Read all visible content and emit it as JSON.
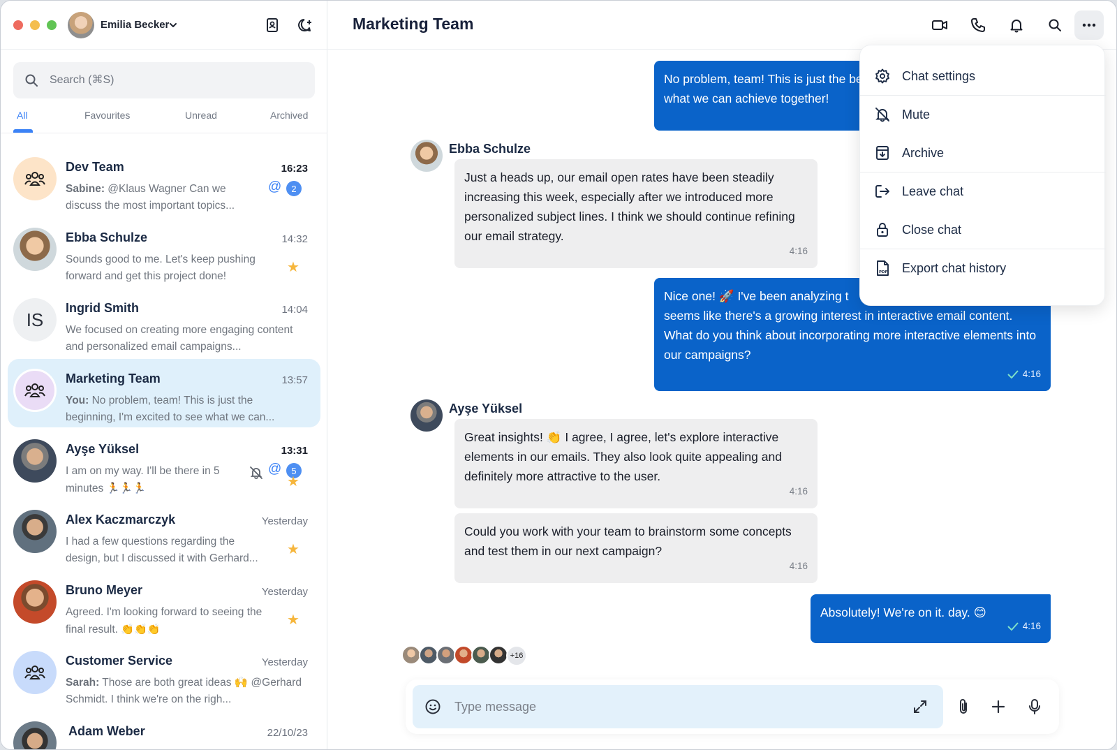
{
  "user": {
    "name": "Emilia Becker"
  },
  "search": {
    "placeholder": "Search (⌘S)"
  },
  "tabs": [
    {
      "label": "All"
    },
    {
      "label": "Favourites"
    },
    {
      "label": "Unread"
    },
    {
      "label": "Archived"
    }
  ],
  "chats": [
    {
      "name": "Dev Team",
      "time": "16:23",
      "sender": "Sabine:",
      "preview": "@Klaus Wagner Can we discuss the most important topics...",
      "badge": "2",
      "at": "@"
    },
    {
      "name": "Ebba Schulze",
      "time": "14:32",
      "preview": "Sounds good to me. Let's keep pushing forward and get this project done!"
    },
    {
      "name": "Ingrid Smith",
      "time": "14:04",
      "initials": "IS",
      "preview": "We focused on creating more engaging content and personalized email campaigns..."
    },
    {
      "name": "Marketing Team",
      "time": "13:57",
      "sender": "You:",
      "preview": "No problem, team! This is just the beginning, I'm excited to see what we can..."
    },
    {
      "name": "Ayşe Yüksel",
      "time": "13:31",
      "preview": "I am on my way. I'll be there in 5 minutes",
      "preview_emoji": "🏃🏃🏃",
      "badge": "5",
      "at": "@"
    },
    {
      "name": "Alex Kaczmarczyk",
      "time": "Yesterday",
      "preview": "I had a few questions regarding the design, but I discussed it with Gerhard..."
    },
    {
      "name": "Bruno Meyer",
      "time": "Yesterday",
      "preview": "Agreed. I'm looking forward to seeing the final result.",
      "preview_emoji": "👏👏👏"
    },
    {
      "name": "Customer Service",
      "time": "Yesterday",
      "sender": "Sarah:",
      "preview": "Those are both great ideas 🙌 @Gerhard Schmidt. I think we're on the righ..."
    },
    {
      "name": "Adam Weber",
      "time": "22/10/23"
    }
  ],
  "header": {
    "title": "Marketing Team"
  },
  "messages": {
    "m1": {
      "text": "No problem, team! This is just the beginning, I'm excited to see what we can achieve together!",
      "visible_text": "No problem, team! This is just the what we can achieve together!"
    },
    "m2": {
      "sender": "Ebba Schulze",
      "text": "Just a heads up, our email open rates have been steadily increasing this week, especially after we introduced more personalized subject lines. I think we should continue refining our email strategy.",
      "time": "4:16"
    },
    "m3": {
      "text": "Nice one! 🚀 I've been analyzing the data and it seems like there's a growing interest in interactive email content. What do you think about incorporating more interactive elements into our campaigns?",
      "line1": "Nice one! 🚀 I've been analyzing t",
      "rest": "seems like there's a growing interest in interactive email content. What do you think about incorporating more interactive elements into our campaigns?",
      "time": "4:16"
    },
    "m4": {
      "sender": "Ayşe Yüksel",
      "text": "Great insights! 👏 I agree, I agree, let's explore interactive elements in our emails. They also look quite appealing and definitely more attractive to the user.",
      "time": "4:16"
    },
    "m5": {
      "text": "Could you work with your team to brainstorm some concepts and test them in our next campaign?",
      "time": "4:16"
    },
    "m6": {
      "text": "Absolutely! We're on it. day. 😊",
      "time": "4:16"
    }
  },
  "readers": {
    "more": "+16"
  },
  "composer": {
    "placeholder": "Type message"
  },
  "menu": [
    {
      "label": "Chat settings",
      "icon": "gear-icon"
    },
    {
      "label": "Mute",
      "icon": "bell-off-icon"
    },
    {
      "label": "Archive",
      "icon": "archive-icon"
    },
    {
      "label": "Leave chat",
      "icon": "leave-icon"
    },
    {
      "label": "Close chat",
      "icon": "lock-icon"
    },
    {
      "label": "Export chat history",
      "icon": "pdf-file-icon"
    }
  ],
  "colors": {
    "accent": "#3b82f6",
    "outgoing": "#0a63c9",
    "selected": "#dff0fb",
    "star": "#f6b63c"
  }
}
